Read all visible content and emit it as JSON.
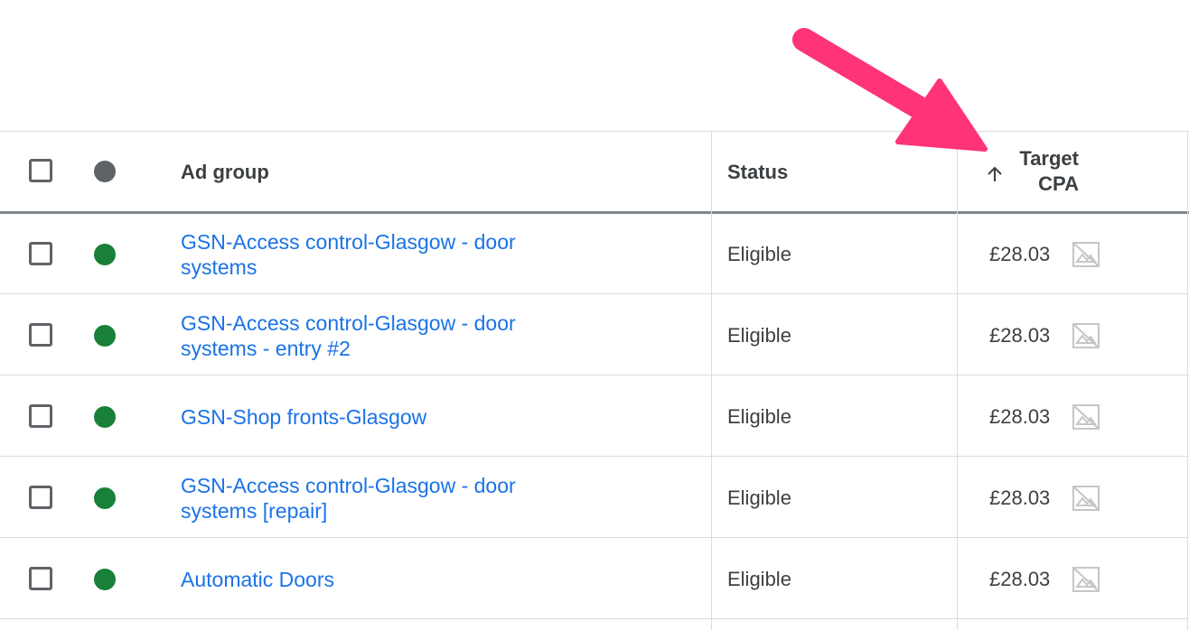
{
  "colors": {
    "link": "#1a73e8",
    "status_green": "#188038",
    "header_dot": "#5f6368",
    "annotation_arrow": "#ff3377"
  },
  "header": {
    "ad_group": "Ad group",
    "status": "Status",
    "target_cpa_line1": "Target",
    "target_cpa_line2": "CPA",
    "sort_icon": "arrow-up-icon",
    "select_all_icon": "checkbox-icon",
    "status_dot_icon": "status-dot-icon"
  },
  "rows": [
    {
      "ad_group_line1": "GSN-Access control-Glasgow - door",
      "ad_group_line2": "systems",
      "status": "Eligible",
      "target_cpa": "£28.03"
    },
    {
      "ad_group_line1": "GSN-Access control-Glasgow - door",
      "ad_group_line2": "systems - entry #2",
      "status": "Eligible",
      "target_cpa": "£28.03"
    },
    {
      "ad_group_line1": "GSN-Shop fronts-Glasgow",
      "ad_group_line2": "",
      "status": "Eligible",
      "target_cpa": "£28.03"
    },
    {
      "ad_group_line1": "GSN-Access control-Glasgow - door",
      "ad_group_line2": "systems [repair]",
      "status": "Eligible",
      "target_cpa": "£28.03"
    },
    {
      "ad_group_line1": "Automatic Doors",
      "ad_group_line2": "",
      "status": "Eligible",
      "target_cpa": "£28.03"
    }
  ],
  "row_icons": {
    "cpa_icon": "no-image-icon"
  }
}
